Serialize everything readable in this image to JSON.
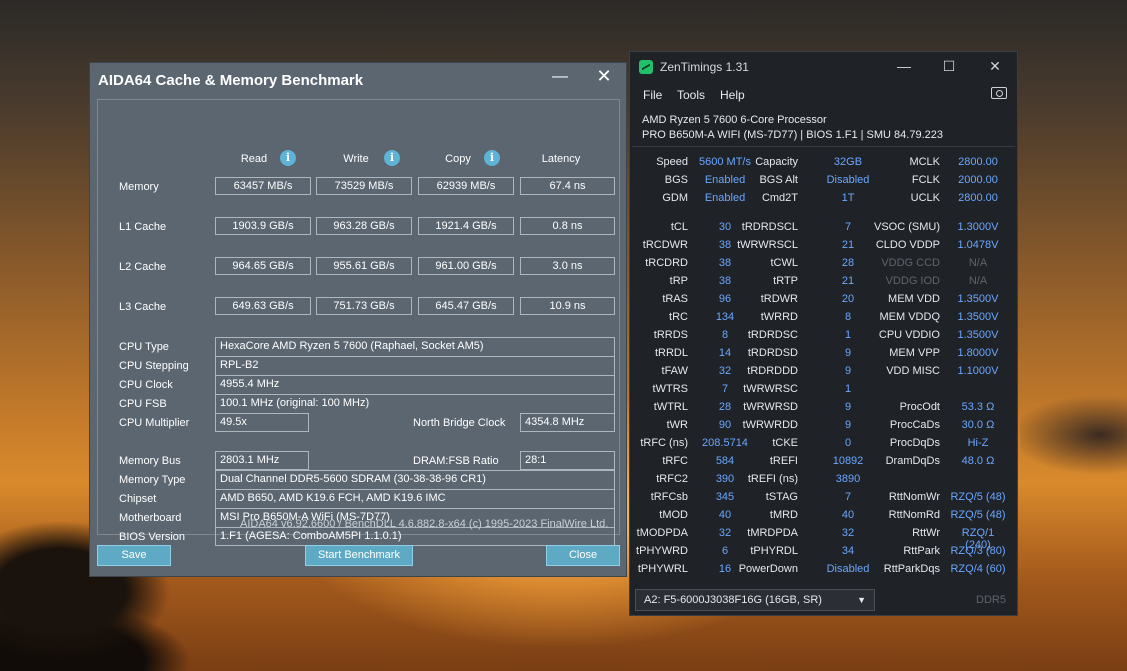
{
  "aida": {
    "title": "AIDA64 Cache & Memory Benchmark",
    "min_glyph": "—",
    "close_glyph": "✕",
    "col_headers": [
      "Read",
      "Write",
      "Copy",
      "Latency"
    ],
    "info_glyph": "i",
    "bench_rows": [
      {
        "label": "Memory",
        "values": [
          "63457 MB/s",
          "73529 MB/s",
          "62939 MB/s",
          "67.4 ns"
        ]
      },
      {
        "label": "L1 Cache",
        "values": [
          "1903.9 GB/s",
          "963.28 GB/s",
          "1921.4 GB/s",
          "0.8 ns"
        ]
      },
      {
        "label": "L2 Cache",
        "values": [
          "964.65 GB/s",
          "955.61 GB/s",
          "961.00 GB/s",
          "3.0 ns"
        ]
      },
      {
        "label": "L3 Cache",
        "values": [
          "649.63 GB/s",
          "751.73 GB/s",
          "645.47 GB/s",
          "10.9 ns"
        ]
      }
    ],
    "cpu_type_label": "CPU Type",
    "cpu_type": "HexaCore AMD Ryzen 5 7600  (Raphael, Socket AM5)",
    "cpu_stepping_label": "CPU Stepping",
    "cpu_stepping": "RPL-B2",
    "cpu_clock_label": "CPU Clock",
    "cpu_clock": "4955.4 MHz",
    "cpu_fsb_label": "CPU FSB",
    "cpu_fsb": "100.1 MHz  (original: 100 MHz)",
    "cpu_mult_label": "CPU Multiplier",
    "cpu_mult": "49.5x",
    "nb_clock_label": "North Bridge Clock",
    "nb_clock": "4354.8 MHz",
    "mem_bus_label": "Memory Bus",
    "mem_bus": "2803.1 MHz",
    "dram_ratio_label": "DRAM:FSB Ratio",
    "dram_ratio": "28:1",
    "mem_type_label": "Memory Type",
    "mem_type": "Dual Channel DDR5-5600 SDRAM  (30-38-38-96 CR1)",
    "chipset_label": "Chipset",
    "chipset": "AMD B650, AMD K19.6 FCH, AMD K19.6 IMC",
    "mobo_label": "Motherboard",
    "mobo": "MSI Pro B650M-A WiFi (MS-7D77)",
    "bios_label": "BIOS Version",
    "bios": "1.F1  (AGESA: ComboAM5PI 1.1.0.1)",
    "footer": "AIDA64 v6.92.6600 / BenchDLL 4.6.882.8-x64  (c) 1995-2023 FinalWire Ltd.",
    "save_label": "Save",
    "start_label": "Start Benchmark",
    "close_label": "Close"
  },
  "zen": {
    "title": "ZenTimings 1.31",
    "min_glyph": "—",
    "max_glyph": "☐",
    "close_glyph": "✕",
    "menu": [
      "File",
      "Tools",
      "Help"
    ],
    "cpu_line1": "AMD Ryzen 5 7600 6-Core Processor",
    "cpu_line2": "PRO B650M-A WIFI (MS-7D77) | BIOS 1.F1 | SMU 84.79.223",
    "top_rows": [
      [
        [
          "Speed",
          "5600 MT/s"
        ],
        [
          "Capacity",
          "32GB"
        ],
        [
          "MCLK",
          "2800.00"
        ]
      ],
      [
        [
          "BGS",
          "Enabled"
        ],
        [
          "BGS Alt",
          "Disabled"
        ],
        [
          "FCLK",
          "2000.00"
        ]
      ],
      [
        [
          "GDM",
          "Enabled"
        ],
        [
          "Cmd2T",
          "1T"
        ],
        [
          "UCLK",
          "2800.00"
        ]
      ]
    ],
    "timing_rows": [
      [
        [
          "tCL",
          "30"
        ],
        [
          "tRDRDSCL",
          "7"
        ],
        [
          "VSOC (SMU)",
          "1.3000V"
        ]
      ],
      [
        [
          "tRCDWR",
          "38"
        ],
        [
          "tWRWRSCL",
          "21"
        ],
        [
          "CLDO VDDP",
          "1.0478V"
        ]
      ],
      [
        [
          "tRCDRD",
          "38"
        ],
        [
          "tCWL",
          "28"
        ],
        [
          "VDDG CCD",
          "N/A"
        ]
      ],
      [
        [
          "tRP",
          "38"
        ],
        [
          "tRTP",
          "21"
        ],
        [
          "VDDG IOD",
          "N/A"
        ]
      ],
      [
        [
          "tRAS",
          "96"
        ],
        [
          "tRDWR",
          "20"
        ],
        [
          "MEM VDD",
          "1.3500V"
        ]
      ],
      [
        [
          "tRC",
          "134"
        ],
        [
          "tWRRD",
          "8"
        ],
        [
          "MEM VDDQ",
          "1.3500V"
        ]
      ],
      [
        [
          "tRRDS",
          "8"
        ],
        [
          "tRDRDSC",
          "1"
        ],
        [
          "CPU VDDIO",
          "1.3500V"
        ]
      ],
      [
        [
          "tRRDL",
          "14"
        ],
        [
          "tRDRDSD",
          "9"
        ],
        [
          "MEM VPP",
          "1.8000V"
        ]
      ],
      [
        [
          "tFAW",
          "32"
        ],
        [
          "tRDRDDD",
          "9"
        ],
        [
          "VDD MISC",
          "1.1000V"
        ]
      ],
      [
        [
          "tWTRS",
          "7"
        ],
        [
          "tWRWRSC",
          "1"
        ],
        [
          "",
          ""
        ]
      ],
      [
        [
          "tWTRL",
          "28"
        ],
        [
          "tWRWRSD",
          "9"
        ],
        [
          "ProcOdt",
          "53.3 Ω"
        ]
      ],
      [
        [
          "tWR",
          "90"
        ],
        [
          "tWRWRDD",
          "9"
        ],
        [
          "ProcCaDs",
          "30.0 Ω"
        ]
      ],
      [
        [
          "tRFC (ns)",
          "208.5714"
        ],
        [
          "tCKE",
          "0"
        ],
        [
          "ProcDqDs",
          "Hi-Z"
        ]
      ],
      [
        [
          "tRFC",
          "584"
        ],
        [
          "tREFI",
          "10892"
        ],
        [
          "DramDqDs",
          "48.0 Ω"
        ]
      ],
      [
        [
          "tRFC2",
          "390"
        ],
        [
          "tREFI (ns)",
          "3890"
        ],
        [
          "",
          ""
        ]
      ],
      [
        [
          "tRFCsb",
          "345"
        ],
        [
          "tSTAG",
          "7"
        ],
        [
          "RttNomWr",
          "RZQ/5 (48)"
        ]
      ],
      [
        [
          "tMOD",
          "40"
        ],
        [
          "tMRD",
          "40"
        ],
        [
          "RttNomRd",
          "RZQ/5 (48)"
        ]
      ],
      [
        [
          "tMODPDA",
          "32"
        ],
        [
          "tMRDPDA",
          "32"
        ],
        [
          "RttWr",
          "RZQ/1 (240)"
        ]
      ],
      [
        [
          "tPHYWRD",
          "6"
        ],
        [
          "tPHYRDL",
          "34"
        ],
        [
          "RttPark",
          "RZQ/3 (80)"
        ]
      ],
      [
        [
          "tPHYWRL",
          "16"
        ],
        [
          "PowerDown",
          "Disabled"
        ],
        [
          "RttParkDqs",
          "RZQ/4 (60)"
        ]
      ]
    ],
    "dimm_select": "A2: F5-6000J3038F16G (16GB, SR)",
    "ddr_label": "DDR5",
    "accent": "#6aa7ff"
  }
}
